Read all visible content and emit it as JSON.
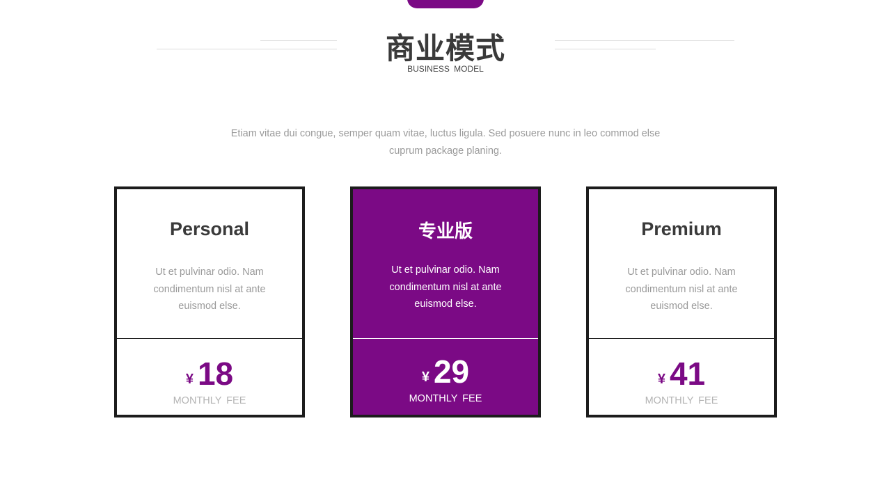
{
  "header": {
    "title": "商业模式",
    "subtitle": "BUSINESS MODEL"
  },
  "intro": {
    "line1": "Etiam vitae dui congue, semper quam vitae, luctus ligula. Sed posuere nunc in leo commod else",
    "line2": "cuprum package planing."
  },
  "plans": [
    {
      "name": "Personal",
      "desc_lines": [
        "Ut et pulvinar odio. Nam",
        "condimentum nisl at ante",
        "euismod else."
      ],
      "currency": "¥",
      "price": "18",
      "fee_label": "MONTHLY FEE"
    },
    {
      "name": "专业版",
      "desc_lines": [
        "Ut et pulvinar odio. Nam",
        "condimentum nisl at ante",
        "euismod else."
      ],
      "currency": "¥",
      "price": "29",
      "fee_label": "MONTHLY FEE"
    },
    {
      "name": "Premium",
      "desc_lines": [
        "Ut et pulvinar odio. Nam",
        "condimentum nisl at ante",
        "euismod else."
      ],
      "currency": "¥",
      "price": "41",
      "fee_label": "MONTHLY FEE"
    }
  ],
  "colors": {
    "accent": "#7b0a85",
    "title": "#3a3a3a",
    "muted_text": "#9a9a9a",
    "border": "#1c1c1c"
  }
}
